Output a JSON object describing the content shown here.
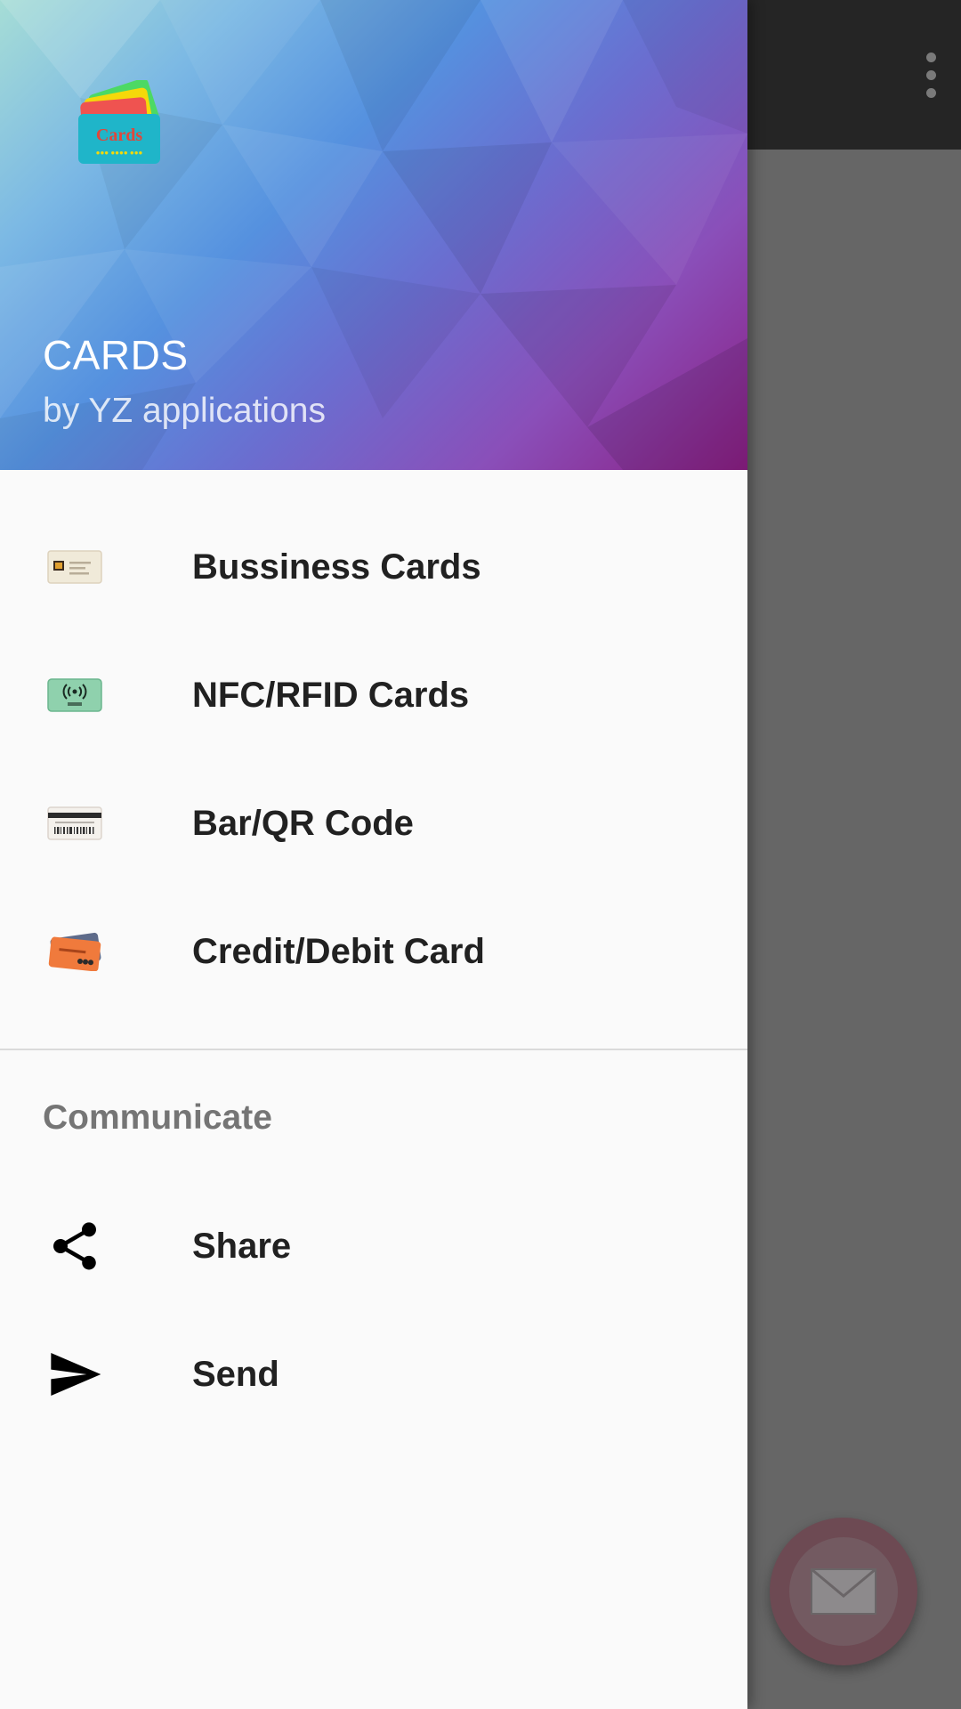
{
  "app": {
    "title": "CARDS",
    "subtitle": "by YZ applications",
    "logo_text": "Cards"
  },
  "drawer": {
    "items": [
      {
        "label": "Bussiness Cards",
        "icon": "business-card-icon"
      },
      {
        "label": "NFC/RFID Cards",
        "icon": "rfid-card-icon"
      },
      {
        "label": "Bar/QR Code",
        "icon": "barcode-card-icon"
      },
      {
        "label": "Credit/Debit Card",
        "icon": "credit-card-icon"
      }
    ],
    "section_title": "Communicate",
    "comm_items": [
      {
        "label": "Share",
        "icon": "share-icon"
      },
      {
        "label": "Send",
        "icon": "send-icon"
      }
    ]
  },
  "colors": {
    "drawer_bg": "#fafafa",
    "scrim": "#666666",
    "toolbar": "#252525",
    "text_primary": "#212121",
    "text_secondary": "#757575",
    "fab": "#6d4a53"
  },
  "icons": {
    "overflow": "more-vert-icon",
    "fab": "mail-icon"
  }
}
